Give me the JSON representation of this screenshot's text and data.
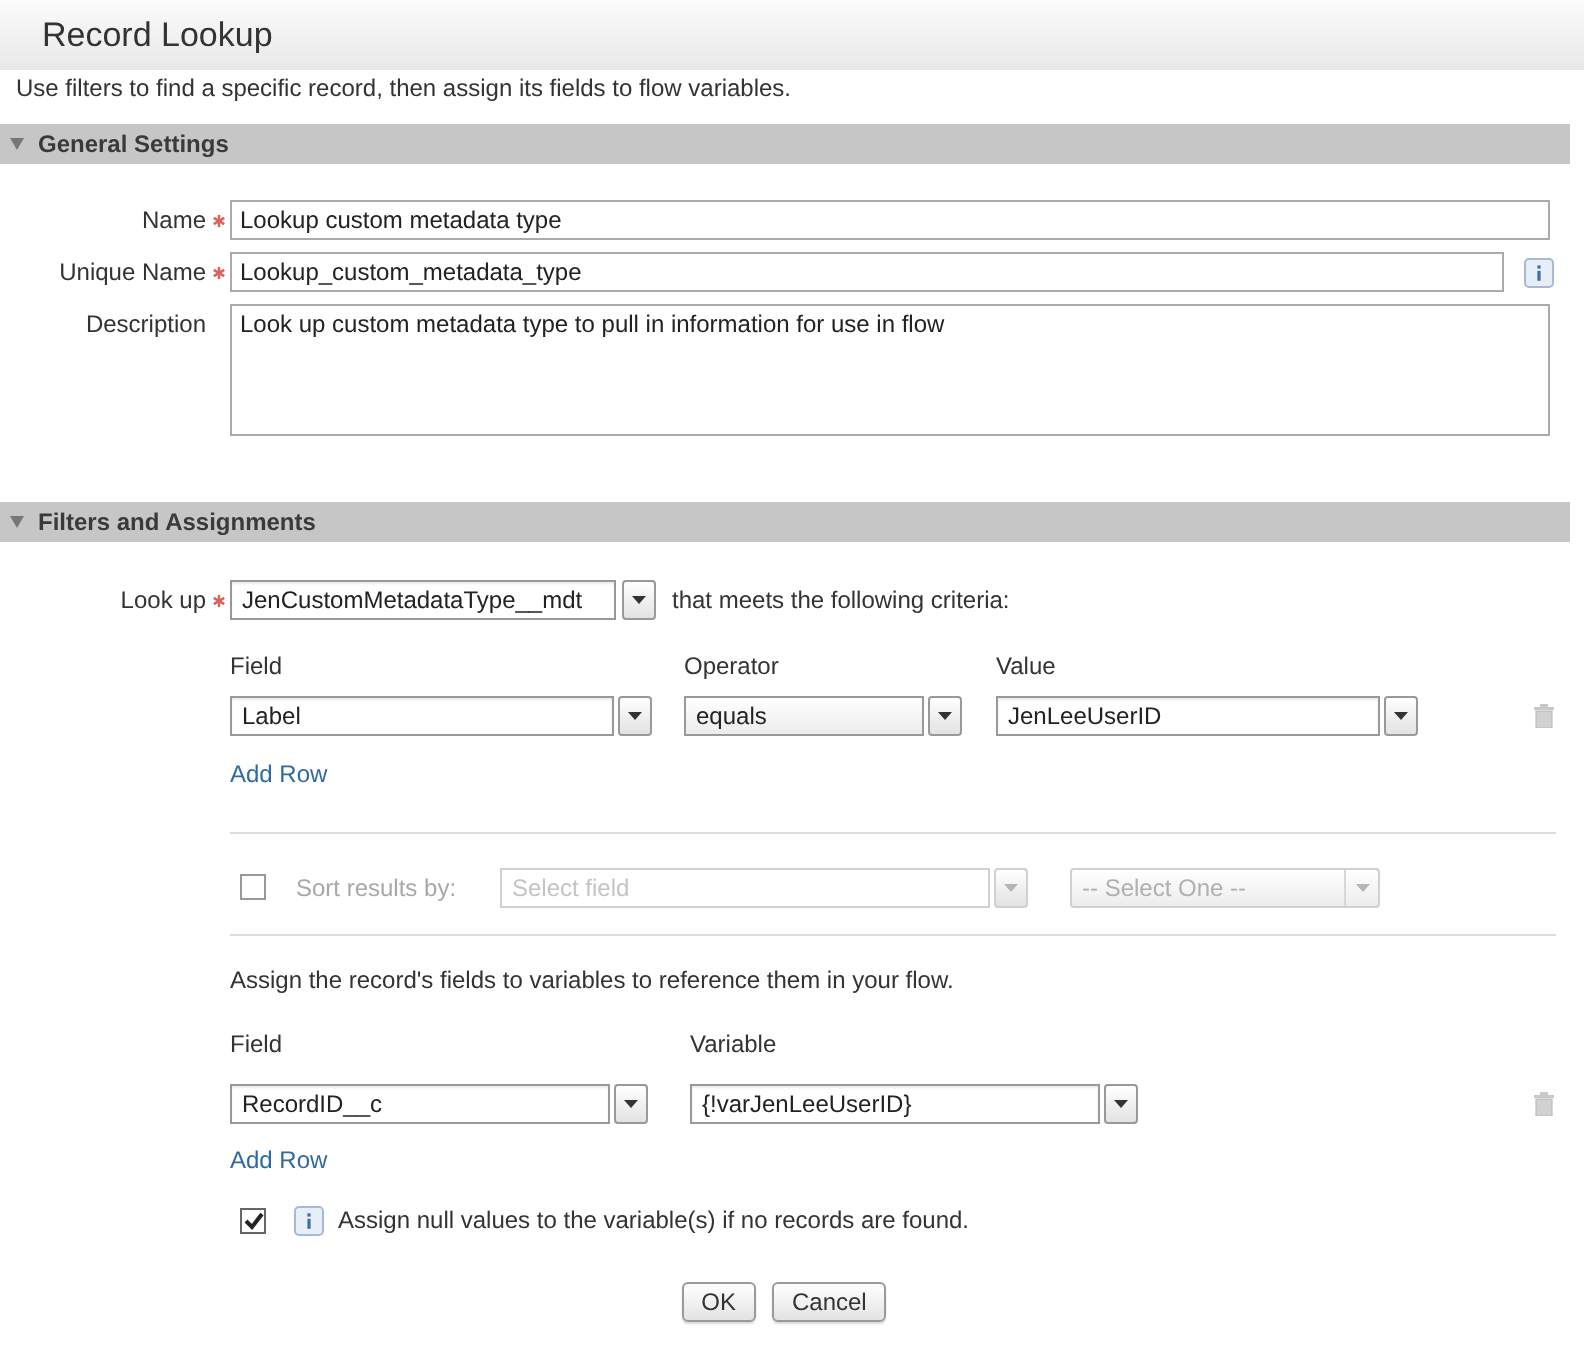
{
  "window": {
    "title": "Record Lookup"
  },
  "instructions": "Use filters to find a specific record, then assign its fields to flow variables.",
  "general_settings": {
    "title": "General Settings",
    "expanded": true,
    "fields": [
      {
        "kind": "text",
        "label": "Name",
        "required": true,
        "value": "Lookup custom metadata type"
      },
      {
        "kind": "text-info",
        "label": "Unique Name",
        "required": true,
        "value": "Lookup_custom_metadata_type"
      },
      {
        "kind": "textarea",
        "label": "Description",
        "required": false,
        "value": "Look up custom metadata type to pull in information for use in flow"
      }
    ]
  },
  "filters_and_assignments": {
    "title": "Filters and Assignments",
    "expanded": true,
    "lookup": {
      "label": "Look up",
      "required": true,
      "value": "JenCustomMetadataType__mdt",
      "criteria_text": "that meets the following criteria:"
    },
    "criteria": {
      "columns": [
        "Field",
        "Operator",
        "Value"
      ],
      "rows": [
        [
          "Label",
          "equals",
          "JenLeeUserID"
        ]
      ],
      "add_row": "Add Row"
    },
    "sort": {
      "checked": false,
      "disabled": true,
      "label": "Sort results by:",
      "field": {
        "placeholder": "Select field"
      },
      "order": {
        "value": "-- Select One --"
      }
    },
    "assignment": {
      "intro": "Assign the record's fields to variables to reference them in your flow.",
      "columns": [
        "Field",
        "Variable"
      ],
      "rows": [
        [
          "RecordID__c",
          "{!varJenLeeUserID}"
        ]
      ],
      "add_row": "Add Row"
    },
    "assign_null": {
      "checked": true,
      "label": "Assign null values to the variable(s) if no records are found."
    }
  },
  "buttons": [
    "OK",
    "Cancel"
  ]
}
